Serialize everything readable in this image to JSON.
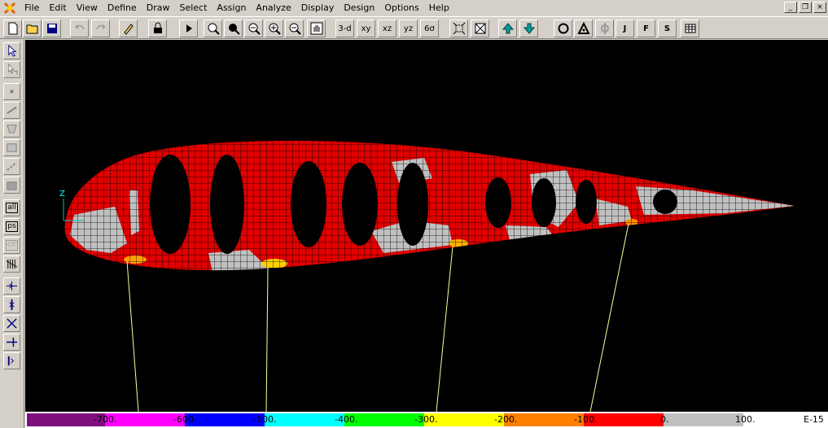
{
  "menu": [
    "File",
    "Edit",
    "View",
    "Define",
    "Draw",
    "Select",
    "Assign",
    "Analyze",
    "Display",
    "Design",
    "Options",
    "Help"
  ],
  "window_controls": [
    "_",
    "❐",
    "×"
  ],
  "toolbar": {
    "view_3d": "3-d",
    "view_xy": "xy",
    "view_xz": "xz",
    "view_yz": "yz",
    "view_perspective": "6σ",
    "section_j": "J",
    "section_f": "F",
    "section_s": "S"
  },
  "sidebar": {
    "all_label": "all",
    "ps_label": "ps",
    "clr_label": "clr"
  },
  "axis": {
    "z_label": "Z"
  },
  "legend": {
    "labels": [
      "-700.",
      "-600.",
      "-500.",
      "-400.",
      "-300.",
      "-200.",
      "-100.",
      "0.",
      "100."
    ],
    "units_label": "E-15",
    "colors": [
      "#7f0f7f",
      "#ff00ff",
      "#0000ff",
      "#00ffff",
      "#00ff00",
      "#ffff00",
      "#ff8000",
      "#ff0000",
      "#c0c0c0",
      "#ffffff"
    ]
  },
  "colors": {
    "plot_background": "#000000",
    "stress_fill": "#e00000",
    "mesh_line": "#000000",
    "low_stress_gray": "#c0c0c0",
    "hotspot_orange": "#ffa000",
    "leader_line": "#ffff99"
  }
}
